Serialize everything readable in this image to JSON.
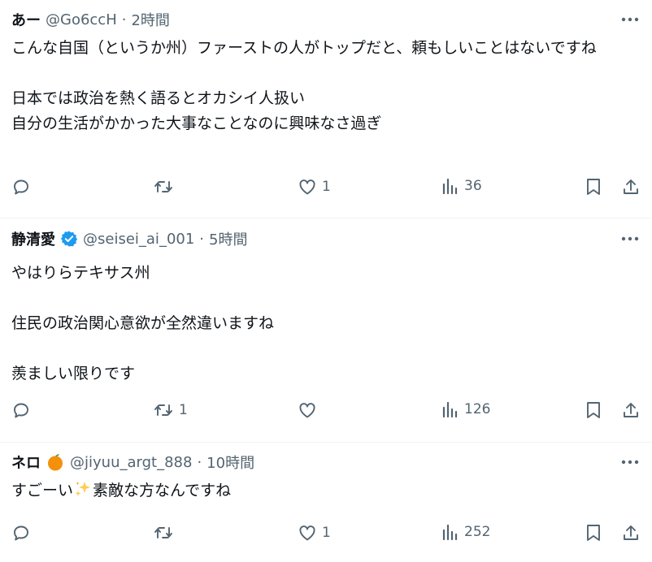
{
  "posts": [
    {
      "name": "あー",
      "handle": "@Go6ccH",
      "sep": "·",
      "time": "2時間",
      "text": "こんな自国（というか州）ファーストの人がトップだと、頼もしいことはないですね\n\n日本では政治を熱く語るとオカシイ人扱い\n自分の生活がかかった大事なことなのに興味なさ過ぎ",
      "reply_count": "",
      "repost_count": "",
      "like_count": "1",
      "view_count": "36"
    },
    {
      "name": "静清愛",
      "handle": "@seisei_ai_001",
      "sep": "·",
      "time": "5時間",
      "text": "やはりらテキサス州\n\n住民の政治関心意欲が全然違いますね\n\n羨ましい限りです",
      "reply_count": "",
      "repost_count": "1",
      "like_count": "",
      "view_count": "126"
    },
    {
      "name": "ネロ",
      "handle": "@jiyuu_argt_888",
      "sep": "·",
      "time": "10時間",
      "text_before": "すごーい",
      "text_after": "素敵な方なんですね",
      "reply_count": "",
      "repost_count": "",
      "like_count": "1",
      "view_count": "252"
    }
  ],
  "icons": {
    "more": "more-dots-icon",
    "reply": "reply-icon",
    "repost": "repost-icon",
    "like": "like-icon",
    "views": "views-icon",
    "bookmark": "bookmark-icon",
    "share": "share-icon",
    "verified": "verified-badge-icon",
    "name_emoji": "orange-emoji-icon",
    "sparkles": "sparkles-emoji-icon"
  },
  "colors": {
    "text": "#0f1419",
    "secondary": "#536471",
    "verified": "#1d9bf0",
    "divider": "#eff3f4"
  }
}
